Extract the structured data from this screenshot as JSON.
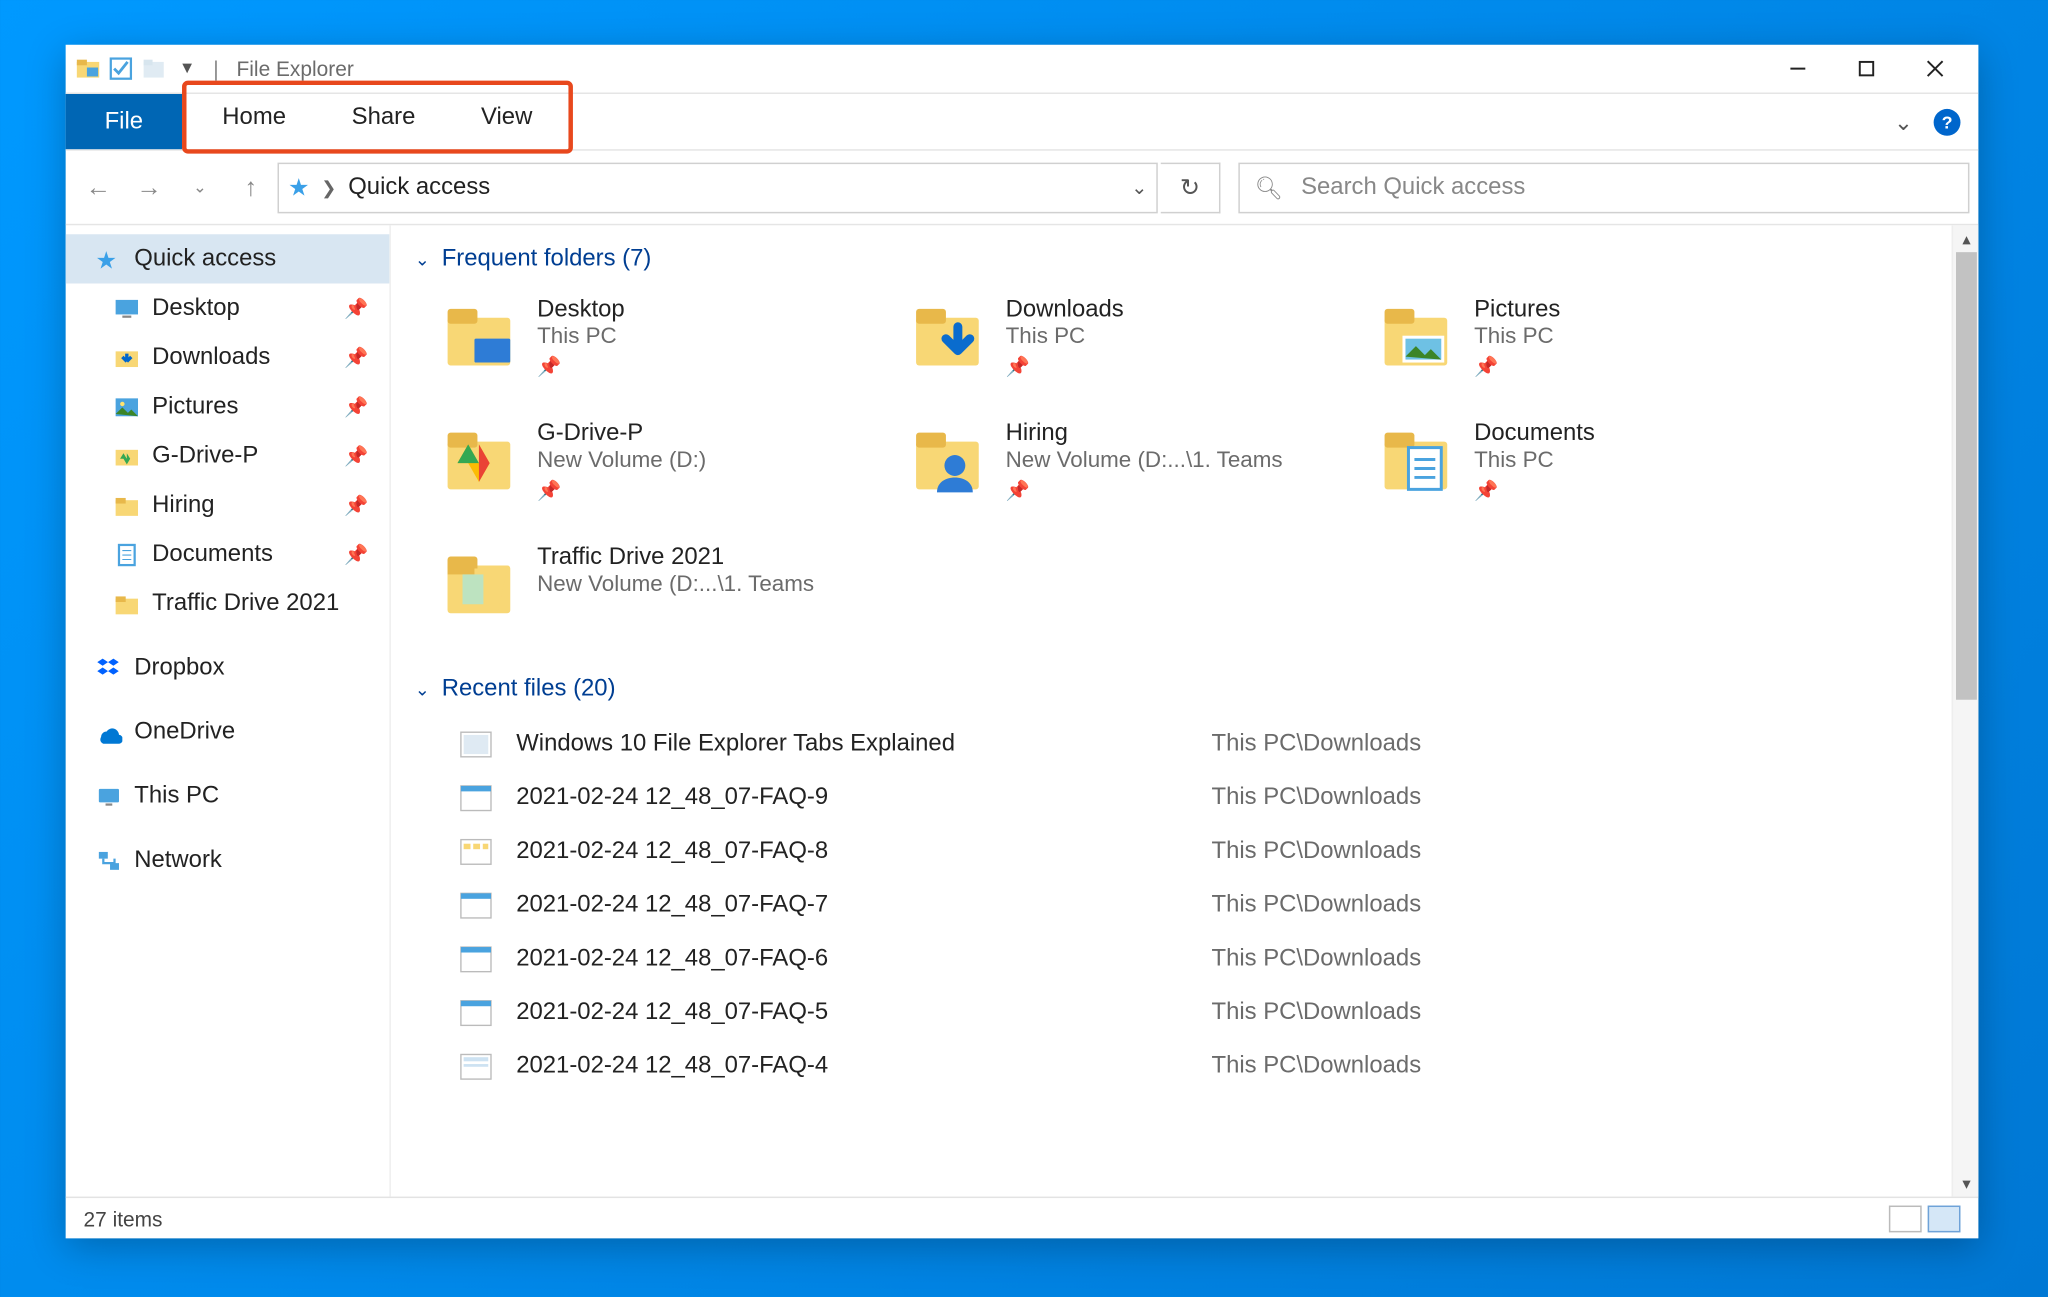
{
  "window": {
    "title": "File Explorer"
  },
  "ribbon": {
    "file": "File",
    "tabs": [
      "Home",
      "Share",
      "View"
    ]
  },
  "nav": {
    "breadcrumb": "Quick access",
    "search_placeholder": "Search Quick access"
  },
  "sidebar": {
    "quick_access": "Quick access",
    "pinned": [
      {
        "label": "Desktop",
        "icon": "desktop"
      },
      {
        "label": "Downloads",
        "icon": "downloads"
      },
      {
        "label": "Pictures",
        "icon": "pictures"
      },
      {
        "label": "G-Drive-P",
        "icon": "gdrive"
      },
      {
        "label": "Hiring",
        "icon": "folder"
      },
      {
        "label": "Documents",
        "icon": "documents"
      }
    ],
    "recent_child": "Traffic Drive 2021",
    "roots": [
      "Dropbox",
      "OneDrive",
      "This PC",
      "Network"
    ]
  },
  "groups": {
    "frequent_header": "Frequent folders (7)",
    "recent_header": "Recent files (20)"
  },
  "frequent": [
    {
      "name": "Desktop",
      "path": "This PC",
      "pinned": true,
      "icon": "desktop"
    },
    {
      "name": "Downloads",
      "path": "This PC",
      "pinned": true,
      "icon": "downloads"
    },
    {
      "name": "Pictures",
      "path": "This PC",
      "pinned": true,
      "icon": "pictures"
    },
    {
      "name": "G-Drive-P",
      "path": "New Volume (D:)",
      "pinned": true,
      "icon": "gdrive"
    },
    {
      "name": "Hiring",
      "path": "New Volume (D:...\\1. Teams",
      "pinned": true,
      "icon": "hiring"
    },
    {
      "name": "Documents",
      "path": "This PC",
      "pinned": true,
      "icon": "documents"
    },
    {
      "name": "Traffic Drive 2021",
      "path": "New Volume (D:...\\1. Teams",
      "pinned": false,
      "icon": "folder-open"
    }
  ],
  "recent": [
    {
      "name": "Windows 10 File Explorer Tabs Explained",
      "path": "This PC\\Downloads",
      "icon": "image"
    },
    {
      "name": "2021-02-24 12_48_07-FAQ-9",
      "path": "This PC\\Downloads",
      "icon": "scr1"
    },
    {
      "name": "2021-02-24 12_48_07-FAQ-8",
      "path": "This PC\\Downloads",
      "icon": "scr2"
    },
    {
      "name": "2021-02-24 12_48_07-FAQ-7",
      "path": "This PC\\Downloads",
      "icon": "scr1"
    },
    {
      "name": "2021-02-24 12_48_07-FAQ-6",
      "path": "This PC\\Downloads",
      "icon": "scr1"
    },
    {
      "name": "2021-02-24 12_48_07-FAQ-5",
      "path": "This PC\\Downloads",
      "icon": "scr1"
    },
    {
      "name": "2021-02-24 12_48_07-FAQ-4",
      "path": "This PC\\Downloads",
      "icon": "scr3"
    }
  ],
  "status": {
    "items": "27 items"
  }
}
